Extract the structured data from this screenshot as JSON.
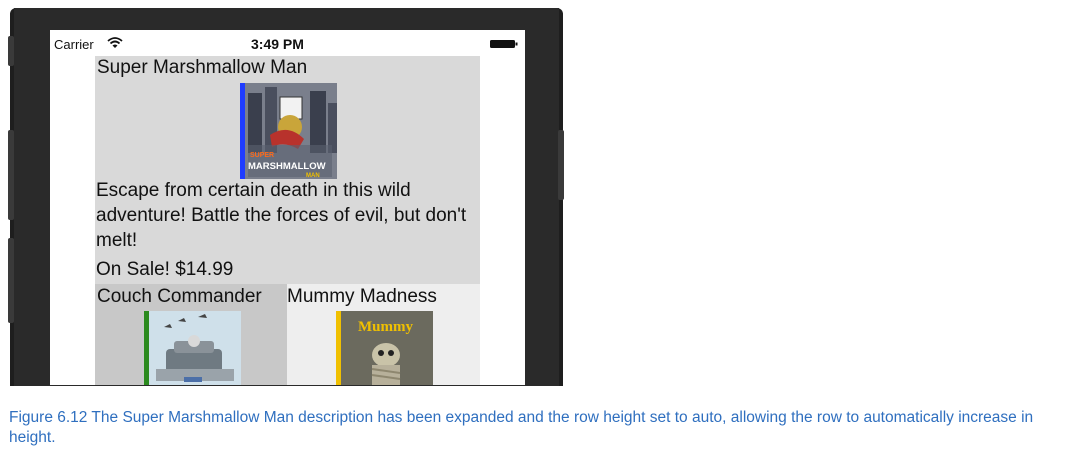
{
  "status_bar": {
    "carrier": "Carrier",
    "time": "3:49 PM"
  },
  "featured": {
    "title": "Super Marshmallow Man",
    "art_text_top": "SUPER",
    "art_text_main": "MARSHMALLOW",
    "art_text_bottom": "MAN",
    "description": "Escape from certain death in this wild adventure! Battle the forces of evil, but don't melt!",
    "price": "On Sale! $14.99"
  },
  "games": [
    {
      "title": "Couch Commander"
    },
    {
      "title": "Mummy Madness",
      "art_text": "Mummy"
    }
  ],
  "caption": "Figure 6.12 The Super Marshmallow Man description has been expanded and the row height set to auto, allowing the row to automatically increase in height.",
  "colors": {
    "caption": "#2f6fbf",
    "featured_row": "#d9d9d9",
    "cell_a": "#c8c8c8",
    "cell_b": "#eeeeee",
    "accent_blue": "#1f3cff",
    "accent_green": "#2b8a1e",
    "accent_yellow": "#f0c000"
  }
}
